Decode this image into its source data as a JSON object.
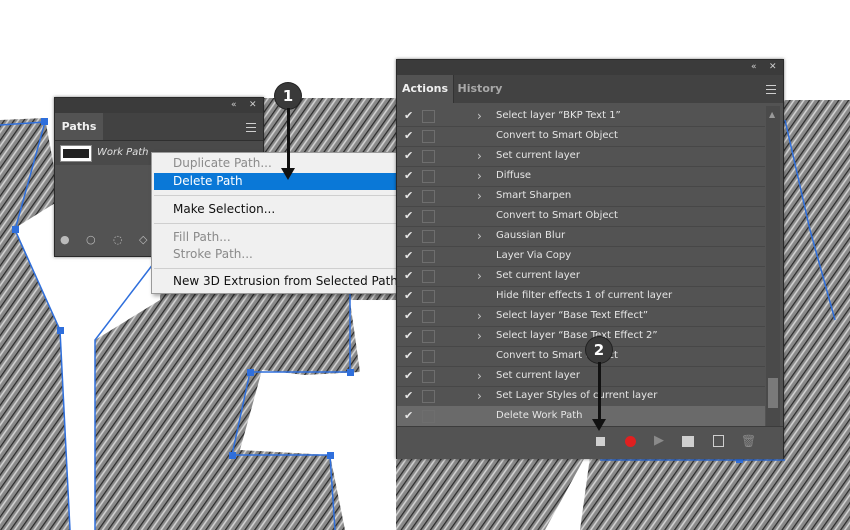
{
  "colors": {
    "panel": "#535353",
    "highlight": "#0a78d7",
    "record_red": "#e02020",
    "path_blue": "#2f6fdc"
  },
  "paths_panel": {
    "tab_label": "Paths",
    "path_name": "Work Path",
    "collapse_icon": "double-chevron-left-icon",
    "close_icon": "close-icon"
  },
  "context_menu": {
    "items": [
      {
        "label": "Duplicate Path...",
        "disabled": true
      },
      {
        "label": "Delete Path",
        "highlighted": true
      },
      {
        "label": "Make Selection..."
      },
      {
        "label": "Fill Path...",
        "disabled": true
      },
      {
        "label": "Stroke Path...",
        "disabled": true
      },
      {
        "label": "New 3D Extrusion from Selected Path"
      }
    ]
  },
  "actions_panel": {
    "tabs": [
      "Actions",
      "History"
    ],
    "rows": [
      {
        "label": "Select layer “BKP Text 1”",
        "chevron": true
      },
      {
        "label": "Convert to Smart Object",
        "chevron": false
      },
      {
        "label": "Set current layer",
        "chevron": true
      },
      {
        "label": "Diffuse",
        "chevron": true
      },
      {
        "label": "Smart Sharpen",
        "chevron": true
      },
      {
        "label": "Convert to Smart Object",
        "chevron": false
      },
      {
        "label": "Gaussian Blur",
        "chevron": true
      },
      {
        "label": "Layer Via Copy",
        "chevron": false
      },
      {
        "label": "Set current layer",
        "chevron": true
      },
      {
        "label": "Hide filter effects 1 of current layer",
        "chevron": false
      },
      {
        "label": "Select layer “Base Text Effect”",
        "chevron": true
      },
      {
        "label": "Select layer “Base Text Effect 2”",
        "chevron": true
      },
      {
        "label": "Convert to Smart Object",
        "chevron": false
      },
      {
        "label": "Set current layer",
        "chevron": true
      },
      {
        "label": "Set Layer Styles of current layer",
        "chevron": true
      },
      {
        "label": "Delete Work Path",
        "chevron": false,
        "selected": true
      }
    ],
    "bottom_icons": [
      "stop-icon",
      "record-icon",
      "play-icon",
      "folder-icon",
      "new-action-icon",
      "trash-icon"
    ]
  },
  "callouts": [
    "1",
    "2"
  ]
}
